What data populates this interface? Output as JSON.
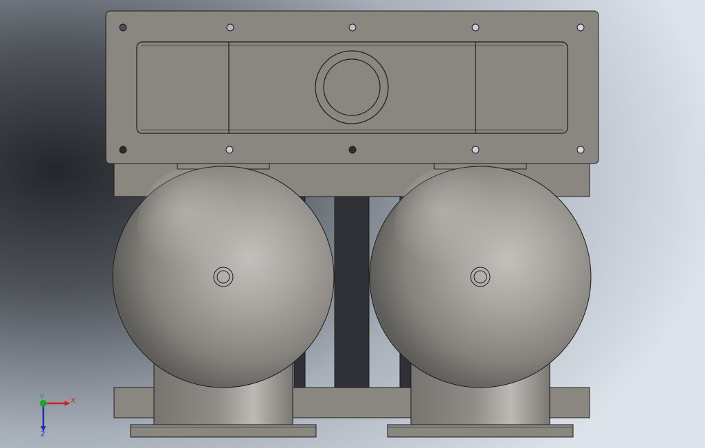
{
  "view": {
    "background_light": "#d6dde6",
    "background_dark": "#2a2c31",
    "part_color": "#8a8781",
    "edge_color": "#1c1c1c"
  },
  "triad": {
    "x_label": "X",
    "y_label": "Y",
    "z_label": "Z",
    "x_color": "#d0211c",
    "y_color": "#1fa12a",
    "z_color": "#1d2fb8"
  }
}
